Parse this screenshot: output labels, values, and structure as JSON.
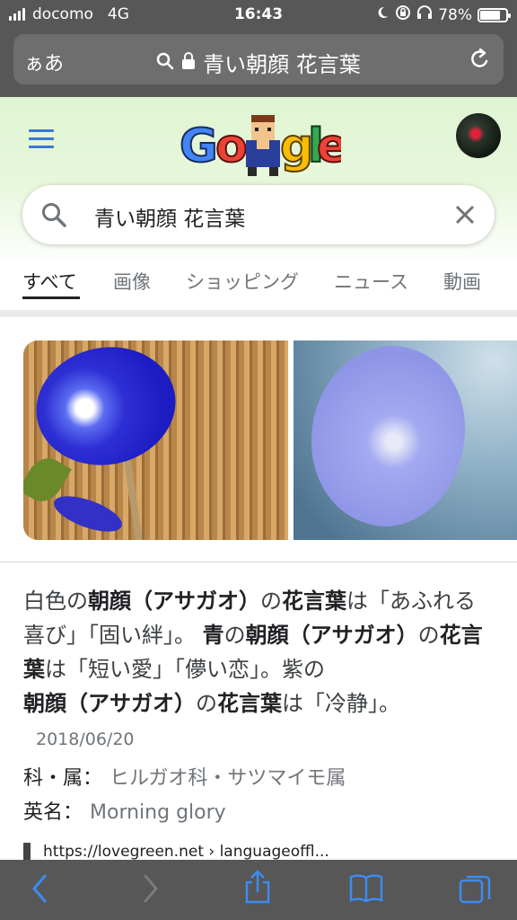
{
  "status": {
    "carrier": "docomo",
    "network": "4G",
    "time": "16:43",
    "battery": "78%",
    "battery_level": 0.78
  },
  "urlbar": {
    "aa_label": "ぁあ",
    "query": "青い朝顔 花言葉"
  },
  "search": {
    "query": "青い朝顔 花言葉"
  },
  "tabs": [
    {
      "label": "すべて",
      "active": true
    },
    {
      "label": "画像",
      "active": false
    },
    {
      "label": "ショッピング",
      "active": false
    },
    {
      "label": "ニュース",
      "active": false
    },
    {
      "label": "動画",
      "active": false
    }
  ],
  "snippet": {
    "line1_pre": "白色の",
    "line1_b1": "朝顔（アサガオ）",
    "line1_mid": "の",
    "line1_b2": "花言葉",
    "line1_post": "は「あふれる喜び」「固い絆」。",
    "line2_b1": "青",
    "line2_mid": "の",
    "line2_b2": "朝顔（アサガオ）",
    "line2_mid2": "の",
    "line2_b3": "花言葉",
    "line2_post": "は「短い愛」「儚い恋」。",
    "line3_pre": "紫の",
    "line3_b1": "朝顔（アサガオ）",
    "line3_mid": "の",
    "line3_b2": "花言葉",
    "line3_post": "は「冷静」。",
    "date": "2018/06/20"
  },
  "facts": [
    {
      "label": "科・属：",
      "value": "ヒルガオ科・サツマイモ属"
    },
    {
      "label": "英名：",
      "value": "Morning glory"
    }
  ],
  "source": {
    "url": "https://lovegreen.net › languageoffl..."
  },
  "colors": {
    "chrome_bg": "#575757",
    "hamburger": "#3a78d8",
    "toolbar_icon": "#3b8cf0"
  }
}
